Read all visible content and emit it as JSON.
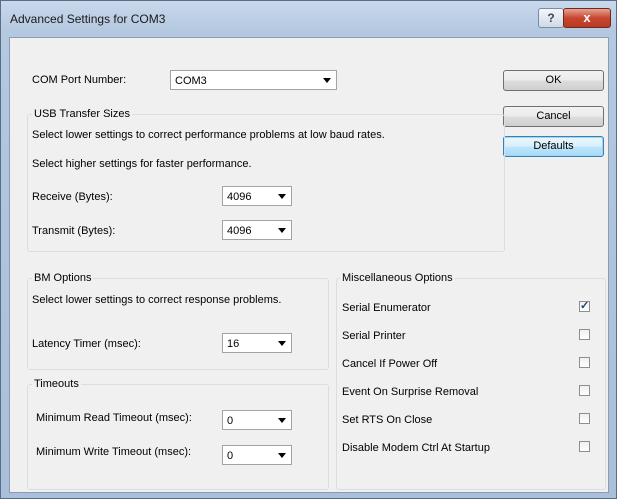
{
  "window": {
    "title": "Advanced Settings for COM3",
    "help_label": "?",
    "close_label": "x"
  },
  "com_port": {
    "label": "COM Port Number:",
    "value": "COM3"
  },
  "buttons": {
    "ok": "OK",
    "cancel": "Cancel",
    "defaults": "Defaults"
  },
  "usb": {
    "legend": "USB Transfer Sizes",
    "line1": "Select lower settings to correct performance problems at low baud rates.",
    "line2": "Select higher settings for faster performance.",
    "receive_label": "Receive (Bytes):",
    "receive_value": "4096",
    "transmit_label": "Transmit (Bytes):",
    "transmit_value": "4096"
  },
  "bm": {
    "legend": "BM Options",
    "line1": "Select lower settings to correct response problems.",
    "latency_label": "Latency Timer (msec):",
    "latency_value": "16"
  },
  "timeouts": {
    "legend": "Timeouts",
    "read_label": "Minimum Read Timeout (msec):",
    "read_value": "0",
    "write_label": "Minimum Write Timeout (msec):",
    "write_value": "0"
  },
  "misc": {
    "legend": "Miscellaneous Options",
    "options": [
      {
        "label": "Serial Enumerator",
        "checked": true
      },
      {
        "label": "Serial Printer",
        "checked": false
      },
      {
        "label": "Cancel If Power Off",
        "checked": false
      },
      {
        "label": "Event On Surprise Removal",
        "checked": false
      },
      {
        "label": "Set RTS On Close",
        "checked": false
      },
      {
        "label": "Disable Modem Ctrl At Startup",
        "checked": false
      }
    ]
  }
}
